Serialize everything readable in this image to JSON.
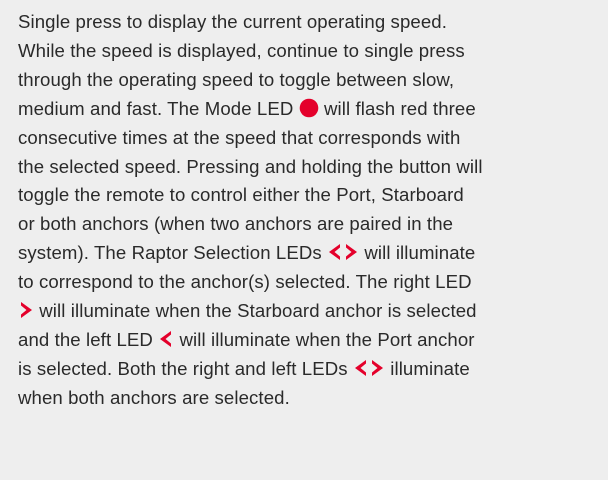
{
  "text": {
    "l1": "Single press to display the current operating speed.",
    "l2": "While the speed is displayed, continue to single press",
    "l3": "through the operating speed to toggle between slow,",
    "l4a": "medium and fast. The Mode LED",
    "l4b": "will flash red three",
    "l5": "consecutive times at the speed that corresponds with",
    "l6": "the selected speed. Pressing and holding the button will",
    "l7": "toggle the remote to control either the Port, Starboard",
    "l8": "or both anchors (when two anchors are paired in the",
    "l9a": "system). The Raptor Selection LEDs",
    "l9b": "will illuminate",
    "l10": "to correspond to the anchor(s) selected. The right LED",
    "l11b": "will illuminate when the Starboard anchor is selected",
    "l12a": "and the left LED",
    "l12b": "will illuminate when the Port anchor",
    "l13a": "is selected. Both the right and left LEDs",
    "l13b": "illuminate",
    "l14": "when both anchors are selected."
  },
  "icons": {
    "mode_led": "red-circle-led-icon",
    "left_led": "left-chevron-led-icon",
    "right_led": "right-chevron-led-icon"
  },
  "colors": {
    "background": "#eeeeee",
    "text": "#2a2a2a",
    "led_red": "#e4002b"
  }
}
